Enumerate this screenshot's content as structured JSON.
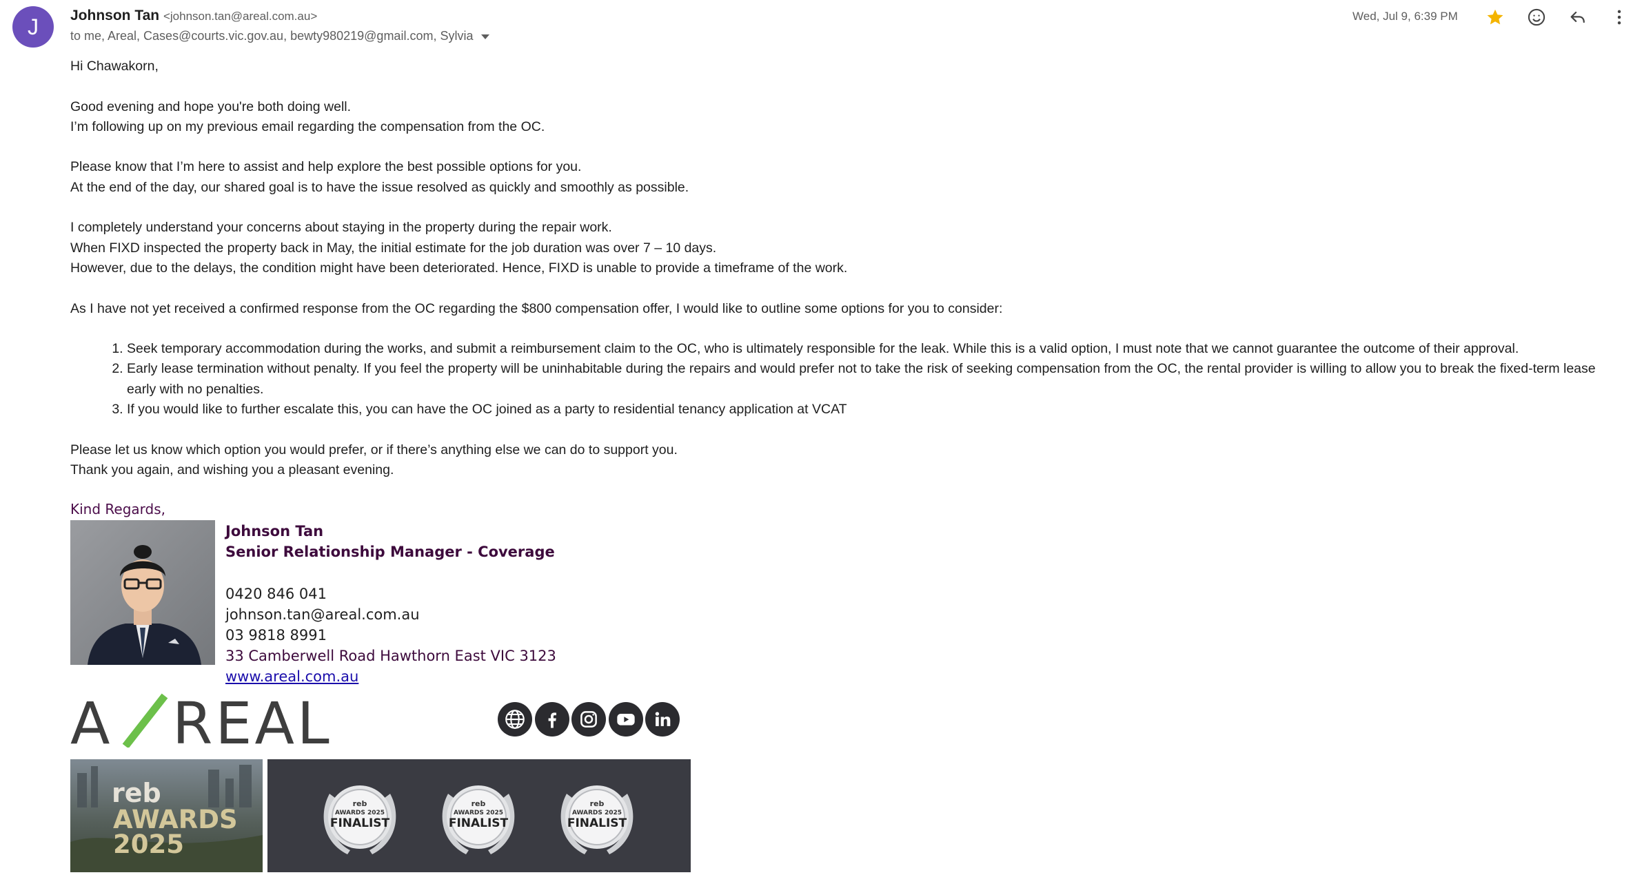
{
  "header": {
    "avatar_letter": "J",
    "sender_name": "Johnson Tan",
    "sender_email": "<johnson.tan@areal.com.au>",
    "recipients": "to me, Areal, Cases@courts.vic.gov.au, bewty980219@gmail.com, Sylvia",
    "date": "Wed, Jul 9, 6:39 PM",
    "starred": true,
    "accent_star_color": "#f4b400",
    "avatar_color": "#6b4fbb"
  },
  "body": {
    "greeting": "Hi Chawakorn,",
    "p1_l1": "Good evening and hope you're both doing well.",
    "p1_l2": "I’m following up on my previous email regarding the compensation from the OC.",
    "p2_l1": "Please know that I’m here to assist and help explore the best possible options for you.",
    "p2_l2": "At the end of the day, our shared goal is to have the issue resolved as quickly and smoothly as possible.",
    "p3_l1": "I completely understand your concerns about staying in the property during the repair work.",
    "p3_l2": "When FIXD inspected the property back in May, the initial estimate for the job duration was over 7 – 10 days.",
    "p3_l3": "However, due to the delays, the condition might have been deteriorated. Hence, FIXD is unable to provide a timeframe of the work.",
    "p4": "As I have not yet received a confirmed response from the OC regarding the $800 compensation offer, I would like to outline some options for you to consider:",
    "options": [
      "Seek temporary accommodation during the works, and submit a reimbursement claim to the OC, who is ultimately responsible for the leak. While this is a valid option, I must note that we cannot guarantee the outcome of their approval.",
      "Early lease termination without penalty. If you feel the property will be uninhabitable during the repairs and would prefer not to take the risk of seeking compensation from the OC, the rental provider is willing to allow you to break the fixed-term lease early with no penalties.",
      "If you would like to further escalate this, you can have the OC joined as a party to residential tenancy application at VCAT"
    ],
    "p5_l1": "Please let us know which option you would prefer, or if there’s anything else we can do to support you.",
    "p5_l2": "Thank you again, and wishing you a pleasant evening."
  },
  "signature": {
    "regards": "Kind Regards,",
    "name": "Johnson Tan",
    "title": "Senior Relationship Manager - Coverage",
    "mobile": "0420 846 041",
    "email": "johnson.tan@areal.com.au",
    "phone": "03 9818 8991",
    "address": "33 Camberwell Road Hawthorn East VIC 3123",
    "website": "www.areal.com.au",
    "brand_color": "#3d0a3c",
    "logo_text_left": "A",
    "logo_text_right": "REAL",
    "logo_accent_color": "#6cc04a",
    "social_icons": [
      "globe-icon",
      "facebook-icon",
      "instagram-icon",
      "youtube-icon",
      "linkedin-icon"
    ],
    "awards_left": {
      "line1": "reb",
      "line2": "AWARDS",
      "line3": "2025"
    },
    "medals": [
      {
        "top": "reb",
        "mid": "AWARDS 2025",
        "main": "FINALIST"
      },
      {
        "top": "reb",
        "mid": "AWARDS 2025",
        "main": "FINALIST"
      },
      {
        "top": "reb",
        "mid": "AWARDS 2025",
        "main": "FINALIST"
      }
    ]
  }
}
